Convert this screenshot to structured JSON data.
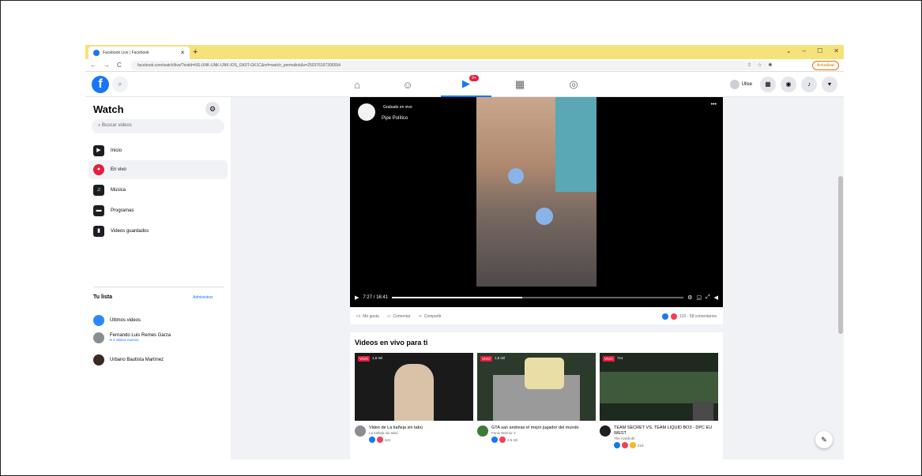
{
  "browser": {
    "tab_title": "Facebook Live | Facebook",
    "url": "facebook.com/watch/live/?extid=NS-UNK-UNK-UNK-IOS_GK0T-GK1C&ref=watch_permalink&v=250376157306554",
    "update_label": "Actualizar",
    "window_controls": [
      "⌄",
      "–",
      "☐",
      "✕"
    ]
  },
  "fb_header": {
    "logo": "f",
    "badge": "9+",
    "user_name": "Ulise"
  },
  "sidebar": {
    "title": "Watch",
    "search_placeholder": "Buscar videos",
    "items": [
      {
        "label": "Inicio",
        "icon": "▶"
      },
      {
        "label": "En vivo",
        "icon": "●"
      },
      {
        "label": "Música",
        "icon": "♫"
      },
      {
        "label": "Programas",
        "icon": "▬"
      },
      {
        "label": "Videos guardados",
        "icon": "▮"
      }
    ],
    "list_title": "Tu lista",
    "admin_label": "Administrar",
    "list": [
      {
        "name": "Últimos videos",
        "sub": ""
      },
      {
        "name": "Fernando Luis Remes Garza",
        "sub": "● 2 videos nuevos"
      },
      {
        "name": "Urbano Bautista Martínez",
        "sub": ""
      }
    ]
  },
  "video": {
    "status": "Grabado en vivo",
    "channel": "Pipe Político",
    "time": "7:27 / 16:41",
    "progress_fraction": 0.446
  },
  "actions": {
    "like": "Me gusta",
    "comment": "Comentar",
    "share": "Compartir",
    "stats": "122 · 58 comentarios"
  },
  "feed": {
    "title": "Videos en vivo para ti",
    "cards": [
      {
        "badge": "VIVO",
        "views": "1,6 mil",
        "title": "Video de La kañeja sin tabú",
        "channel": "La kañeja sin tabú",
        "reactions": "641"
      },
      {
        "badge": "VIVO",
        "views": "1,6 mil",
        "title": "GTA san andreas el mejor jugador del mundo",
        "channel": "Fenix Warrior 2",
        "reactions": "2,5 mil"
      },
      {
        "badge": "VIVO",
        "views": "714",
        "title": "TEAM SECRET VS. TEAM LIQUID BO3 - DPC EU WEST",
        "channel": "The Azathoth",
        "reactions": "218"
      }
    ]
  }
}
